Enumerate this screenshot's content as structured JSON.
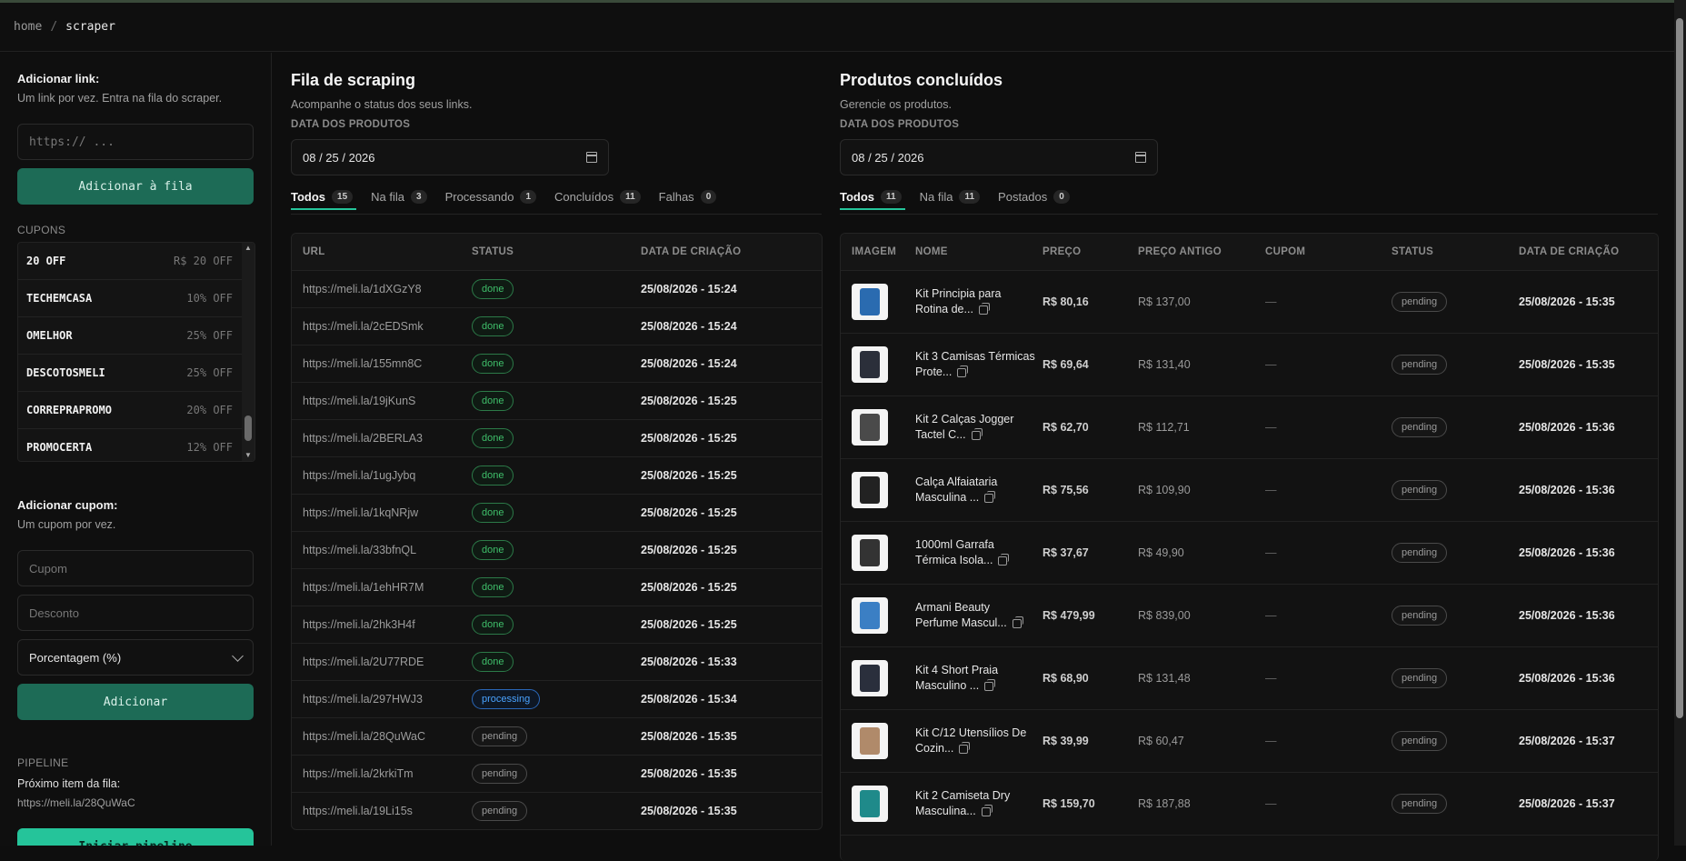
{
  "breadcrumb": {
    "home": "home",
    "separator": "/",
    "current": "scraper"
  },
  "sidebar": {
    "add_link_title": "Adicionar link:",
    "add_link_sub": "Um link por vez. Entra na fila do scraper.",
    "link_placeholder": "https://  ...",
    "add_queue_button": "Adicionar à fila",
    "coupons_label": "CUPONS",
    "coupons": [
      {
        "code": "20 OFF",
        "discount": "R$ 20 OFF"
      },
      {
        "code": "TECHEMCASA",
        "discount": "10% OFF"
      },
      {
        "code": "OMELHOR",
        "discount": "25% OFF"
      },
      {
        "code": "DESCOTOSMELI",
        "discount": "25% OFF"
      },
      {
        "code": "CORREPRAPROMO",
        "discount": "20% OFF"
      },
      {
        "code": "PROMOCERTA",
        "discount": "12% OFF"
      }
    ],
    "add_coupon_title": "Adicionar cupom:",
    "add_coupon_sub": "Um cupom por vez.",
    "coupon_placeholder": "Cupom",
    "discount_placeholder": "Desconto",
    "type_select": "Porcentagem (%)",
    "add_button": "Adicionar",
    "pipeline_label": "PIPELINE",
    "next_item_label": "Próximo item da fila:",
    "next_item_url": "https://meli.la/28QuWaC",
    "start_button": "Iniciar pipeline"
  },
  "queue": {
    "title": "Fila de scraping",
    "subtitle": "Acompanhe o status dos seus links.",
    "date_label": "DATA DOS PRODUTOS",
    "date_value": "08 / 25 / 2026",
    "tabs": [
      {
        "label": "Todos",
        "count": "15"
      },
      {
        "label": "Na fila",
        "count": "3"
      },
      {
        "label": "Processando",
        "count": "1"
      },
      {
        "label": "Concluídos",
        "count": "11"
      },
      {
        "label": "Falhas",
        "count": "0"
      }
    ],
    "columns": [
      "URL",
      "STATUS",
      "DATA DE CRIAÇÃO"
    ],
    "rows": [
      {
        "url": "https://meli.la/1dXGzY8",
        "status": "done",
        "date": "25/08/2026 - 15:24"
      },
      {
        "url": "https://meli.la/2cEDSmk",
        "status": "done",
        "date": "25/08/2026 - 15:24"
      },
      {
        "url": "https://meli.la/155mn8C",
        "status": "done",
        "date": "25/08/2026 - 15:24"
      },
      {
        "url": "https://meli.la/19jKunS",
        "status": "done",
        "date": "25/08/2026 - 15:25"
      },
      {
        "url": "https://meli.la/2BERLA3",
        "status": "done",
        "date": "25/08/2026 - 15:25"
      },
      {
        "url": "https://meli.la/1ugJybq",
        "status": "done",
        "date": "25/08/2026 - 15:25"
      },
      {
        "url": "https://meli.la/1kqNRjw",
        "status": "done",
        "date": "25/08/2026 - 15:25"
      },
      {
        "url": "https://meli.la/33bfnQL",
        "status": "done",
        "date": "25/08/2026 - 15:25"
      },
      {
        "url": "https://meli.la/1ehHR7M",
        "status": "done",
        "date": "25/08/2026 - 15:25"
      },
      {
        "url": "https://meli.la/2hk3H4f",
        "status": "done",
        "date": "25/08/2026 - 15:25"
      },
      {
        "url": "https://meli.la/2U77RDE",
        "status": "done",
        "date": "25/08/2026 - 15:33"
      },
      {
        "url": "https://meli.la/297HWJ3",
        "status": "processing",
        "date": "25/08/2026 - 15:34"
      },
      {
        "url": "https://meli.la/28QuWaC",
        "status": "pending",
        "date": "25/08/2026 - 15:35"
      },
      {
        "url": "https://meli.la/2krkiTm",
        "status": "pending",
        "date": "25/08/2026 - 15:35"
      },
      {
        "url": "https://meli.la/19Li15s",
        "status": "pending",
        "date": "25/08/2026 - 15:35"
      }
    ]
  },
  "products": {
    "title": "Produtos concluídos",
    "subtitle": "Gerencie os produtos.",
    "date_label": "DATA DOS PRODUTOS",
    "date_value": "08 / 25 / 2026",
    "tabs": [
      {
        "label": "Todos",
        "count": "11"
      },
      {
        "label": "Na fila",
        "count": "11"
      },
      {
        "label": "Postados",
        "count": "0"
      }
    ],
    "columns": [
      "IMAGEM",
      "NOME",
      "PREÇO",
      "PREÇO ANTIGO",
      "CUPOM",
      "STATUS",
      "DATA DE CRIAÇÃO"
    ],
    "rows": [
      {
        "line1": "Kit Principia para",
        "line2": "Rotina de...",
        "price": "R$ 80,16",
        "old_price": "R$ 137,00",
        "coupon": "—",
        "status": "pending",
        "date": "25/08/2026 - 15:35",
        "thumb": "#2a6bb0"
      },
      {
        "line1": "Kit 3 Camisas Térmicas",
        "line2": "Prote...",
        "price": "R$ 69,64",
        "old_price": "R$ 131,40",
        "coupon": "—",
        "status": "pending",
        "date": "25/08/2026 - 15:35",
        "thumb": "#2b2f3a"
      },
      {
        "line1": "Kit 2 Calças Jogger",
        "line2": "Tactel C...",
        "price": "R$ 62,70",
        "old_price": "R$ 112,71",
        "coupon": "—",
        "status": "pending",
        "date": "25/08/2026 - 15:36",
        "thumb": "#4a4a4a"
      },
      {
        "line1": "Calça Alfaiataria",
        "line2": "Masculina ...",
        "price": "R$ 75,56",
        "old_price": "R$ 109,90",
        "coupon": "—",
        "status": "pending",
        "date": "25/08/2026 - 15:36",
        "thumb": "#222222"
      },
      {
        "line1": "1000ml Garrafa",
        "line2": "Térmica Isola...",
        "price": "R$ 37,67",
        "old_price": "R$ 49,90",
        "coupon": "—",
        "status": "pending",
        "date": "25/08/2026 - 15:36",
        "thumb": "#333333"
      },
      {
        "line1": "Armani Beauty",
        "line2": "Perfume Mascul...",
        "price": "R$ 479,99",
        "old_price": "R$ 839,00",
        "coupon": "—",
        "status": "pending",
        "date": "25/08/2026 - 15:36",
        "thumb": "#3b7fc4"
      },
      {
        "line1": "Kit 4 Short Praia",
        "line2": "Masculino ...",
        "price": "R$ 68,90",
        "old_price": "R$ 131,48",
        "coupon": "—",
        "status": "pending",
        "date": "25/08/2026 - 15:36",
        "thumb": "#2a2f3c"
      },
      {
        "line1": "Kit C/12 Utensílios De",
        "line2": "Cozin...",
        "price": "R$ 39,99",
        "old_price": "R$ 60,47",
        "coupon": "—",
        "status": "pending",
        "date": "25/08/2026 - 15:37",
        "thumb": "#b08a6a"
      },
      {
        "line1": "Kit 2 Camiseta Dry",
        "line2": "Masculina...",
        "price": "R$ 159,70",
        "old_price": "R$ 187,88",
        "coupon": "—",
        "status": "pending",
        "date": "25/08/2026 - 15:37",
        "thumb": "#1f8a8a"
      }
    ]
  }
}
